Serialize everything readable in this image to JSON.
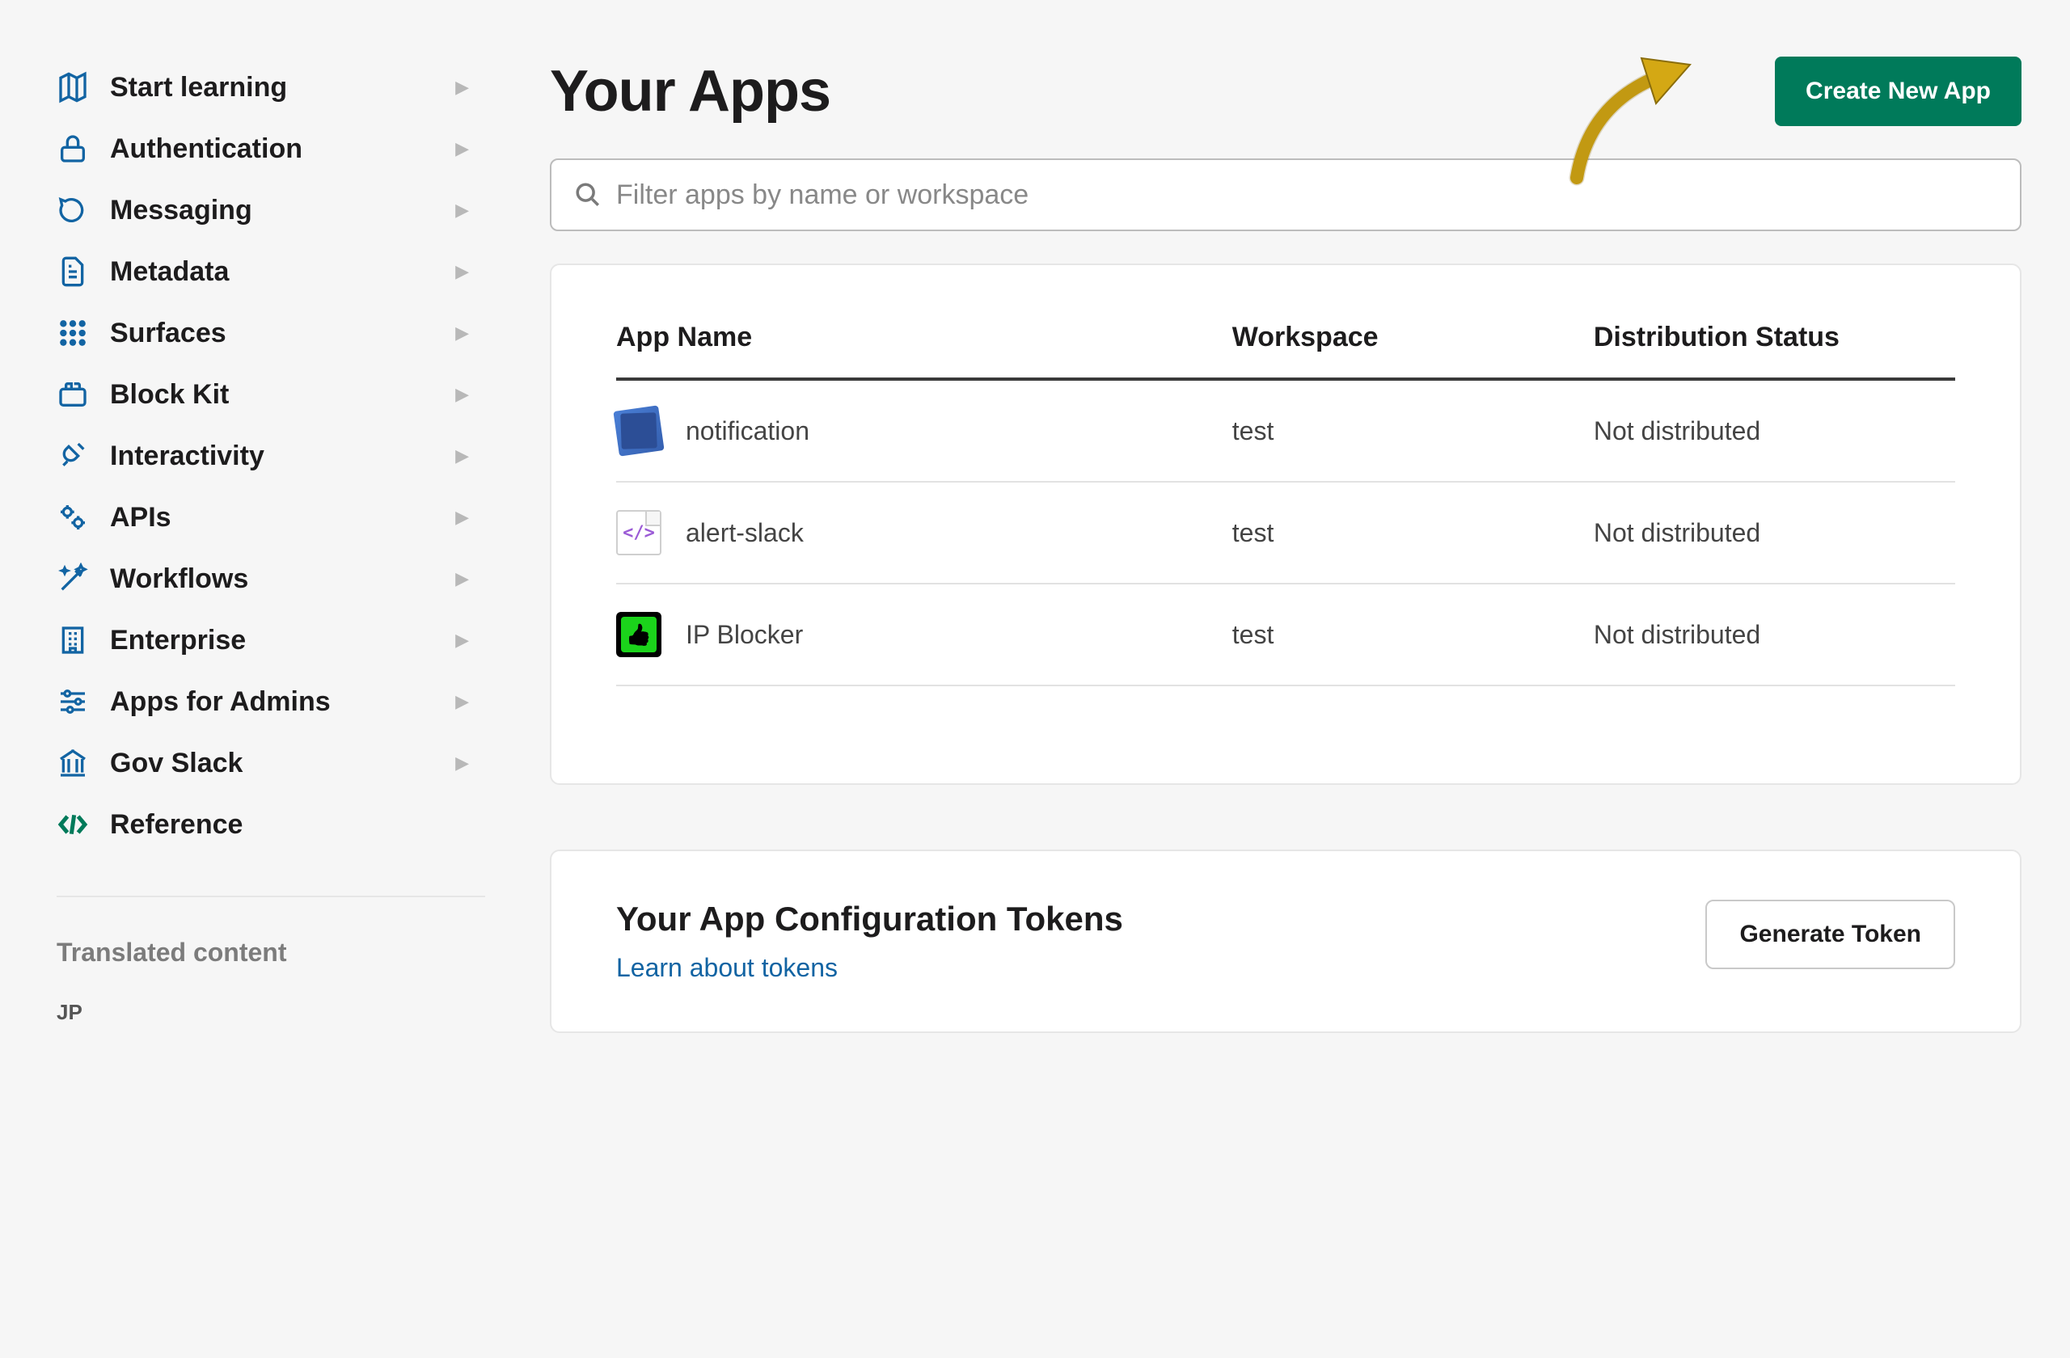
{
  "sidebar": {
    "items": [
      {
        "label": "Start learning",
        "icon": "map"
      },
      {
        "label": "Authentication",
        "icon": "lock"
      },
      {
        "label": "Messaging",
        "icon": "message"
      },
      {
        "label": "Metadata",
        "icon": "metadata"
      },
      {
        "label": "Surfaces",
        "icon": "grid"
      },
      {
        "label": "Block Kit",
        "icon": "block"
      },
      {
        "label": "Interactivity",
        "icon": "plug"
      },
      {
        "label": "APIs",
        "icon": "gears"
      },
      {
        "label": "Workflows",
        "icon": "wand"
      },
      {
        "label": "Enterprise",
        "icon": "building"
      },
      {
        "label": "Apps for Admins",
        "icon": "sliders"
      },
      {
        "label": "Gov Slack",
        "icon": "gov"
      }
    ],
    "reference_label": "Reference",
    "translated_heading": "Translated content",
    "translated_items": [
      "JP"
    ]
  },
  "header": {
    "title": "Your Apps",
    "create_button": "Create New App"
  },
  "filter": {
    "placeholder": "Filter apps by name or workspace"
  },
  "table": {
    "columns": {
      "name": "App Name",
      "workspace": "Workspace",
      "status": "Distribution Status"
    },
    "rows": [
      {
        "name": "notification",
        "workspace": "test",
        "status": "Not distributed",
        "icon": "notification"
      },
      {
        "name": "alert-slack",
        "workspace": "test",
        "status": "Not distributed",
        "icon": "code"
      },
      {
        "name": "IP Blocker",
        "workspace": "test",
        "status": "Not distributed",
        "icon": "ipblocker"
      }
    ]
  },
  "tokens": {
    "title": "Your App Configuration Tokens",
    "link": "Learn about tokens",
    "button": "Generate Token"
  }
}
